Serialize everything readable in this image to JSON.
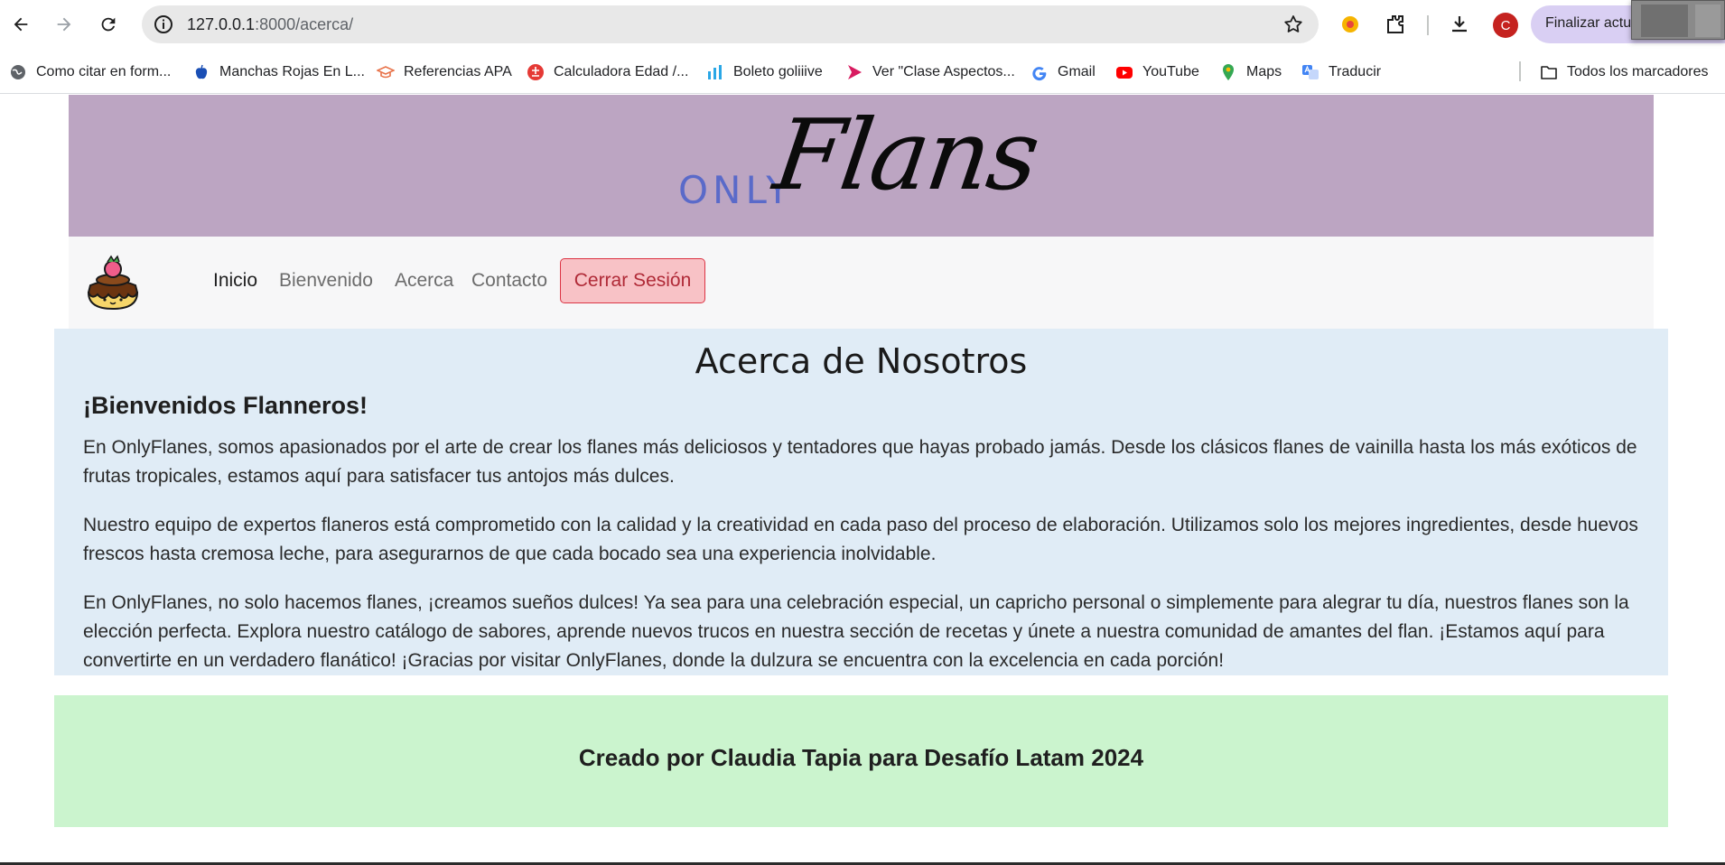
{
  "browser": {
    "url_host": "127.0.0.1",
    "url_path": ":8000/acerca/",
    "profile_initial": "C",
    "update_label": "Finalizar actu",
    "bookmarks": [
      {
        "label": "Como citar en form...",
        "icon": "globe-icon"
      },
      {
        "label": "Manchas Rojas En L...",
        "icon": "apple-icon"
      },
      {
        "label": "Referencias APA",
        "icon": "graduation-cap-icon"
      },
      {
        "label": "Calculadora Edad /...",
        "icon": "calculator-icon"
      },
      {
        "label": "Boleto goliiive",
        "icon": "bars-icon"
      },
      {
        "label": "Ver \"Clase Aspectos...",
        "icon": "play-icon"
      },
      {
        "label": "Gmail",
        "icon": "google-icon"
      },
      {
        "label": "YouTube",
        "icon": "youtube-icon"
      },
      {
        "label": "Maps",
        "icon": "maps-pin-icon"
      },
      {
        "label": "Traducir",
        "icon": "translate-icon"
      }
    ],
    "all_bookmarks_label": "Todos los marcadores"
  },
  "site": {
    "logo_only": "ONLY",
    "logo_flans": "Flans",
    "nav": [
      {
        "label": "Inicio",
        "active": true
      },
      {
        "label": "Bienvenido",
        "active": false
      },
      {
        "label": "Acerca",
        "active": false
      },
      {
        "label": "Contacto",
        "active": false
      }
    ],
    "logout_label": "Cerrar Sesión"
  },
  "about": {
    "title": "Acerca de Nosotros",
    "subtitle": "¡Bienvenidos Flanneros!",
    "paragraphs": [
      "En OnlyFlanes, somos apasionados por el arte de crear los flanes más deliciosos y tentadores que hayas probado jamás. Desde los clásicos flanes de vainilla hasta los más exóticos de frutas tropicales, estamos aquí para satisfacer tus antojos más dulces.",
      "Nuestro equipo de expertos flaneros está comprometido con la calidad y la creatividad en cada paso del proceso de elaboración. Utilizamos solo los mejores ingredientes, desde huevos frescos hasta cremosa leche, para asegurarnos de que cada bocado sea una experiencia inolvidable.",
      "En OnlyFlanes, no solo hacemos flanes, ¡creamos sueños dulces! Ya sea para una celebración especial, un capricho personal o simplemente para alegrar tu día, nuestros flanes son la elección perfecta. Explora nuestro catálogo de sabores, aprende nuevos trucos en nuestra sección de recetas y únete a nuestra comunidad de amantes del flan. ¡Estamos aquí para convertirte en un verdadero flanático! ¡Gracias por visitar OnlyFlanes, donde la dulzura se encuentra con la excelencia en cada porción!"
    ]
  },
  "footer": {
    "credit": "Creado por Claudia Tapia para Desafío Latam 2024"
  },
  "colors": {
    "banner": "#bca5c2",
    "navbar": "#f7f7f8",
    "about_bg": "#e0ecf6",
    "footer_bg": "#cbf4ce",
    "logout_bg": "#f8c2c6",
    "logout_border": "#dc3545",
    "logo_only": "#5a6ac9"
  }
}
